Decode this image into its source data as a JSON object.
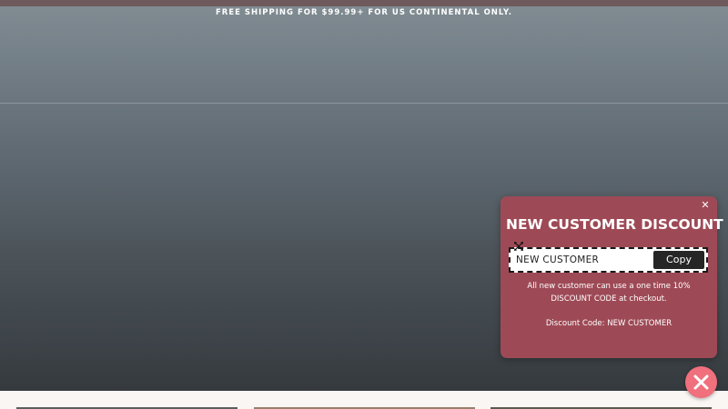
{
  "announcement": {
    "text": "FREE SHIPPING FOR $99.99+ FOR US CONTINENTAL ONLY."
  },
  "popup": {
    "title": "NEW CUSTOMER DISCOUNT",
    "close_icon": "close-icon",
    "code_value": "NEW CUSTOMER",
    "copy_label": "Copy",
    "description": "All new customer can use a one time 10% DISCOUNT CODE at checkout.",
    "code_line": "Discount Code: NEW CUSTOMER",
    "background_color": "#9e4a56"
  },
  "fab": {
    "icon": "close-icon",
    "color": "#f0707d"
  },
  "colors": {
    "top_strip": "#6e5a5c",
    "hero_top": "#808c92",
    "hero_bottom": "#353a3e",
    "copy_button": "#262626"
  }
}
